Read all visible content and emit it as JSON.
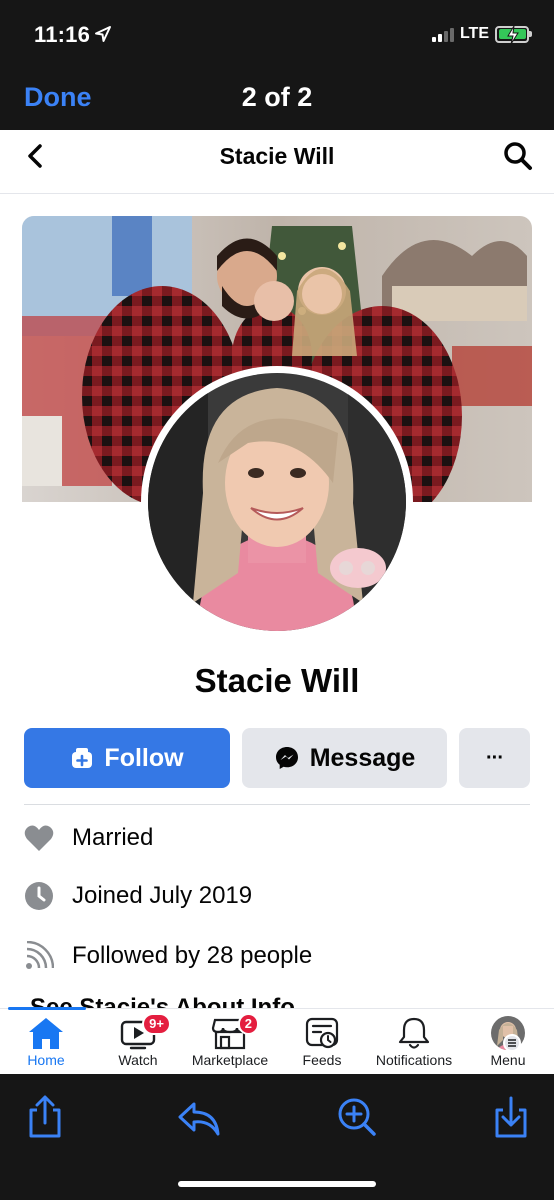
{
  "status": {
    "time": "11:16",
    "network": "LTE"
  },
  "viewer": {
    "done_label": "Done",
    "count": "2 of 2"
  },
  "fb_header": {
    "title": "Stacie Will"
  },
  "profile": {
    "name": "Stacie Will",
    "follow_label": "Follow",
    "message_label": "Message",
    "more_label": "···"
  },
  "info": [
    {
      "icon": "heart-icon",
      "text": "Married"
    },
    {
      "icon": "clock-icon",
      "text": "Joined July 2019"
    },
    {
      "icon": "rss-icon",
      "text": "Followed by 28 people"
    }
  ],
  "partial_text": "See Stacie's About Info",
  "tabs": [
    {
      "label": "Home",
      "icon": "home-icon",
      "active": true
    },
    {
      "label": "Watch",
      "icon": "watch-icon",
      "badge": "9+"
    },
    {
      "label": "Marketplace",
      "icon": "marketplace-icon",
      "badge": "2"
    },
    {
      "label": "Feeds",
      "icon": "feeds-icon"
    },
    {
      "label": "Notifications",
      "icon": "bell-icon"
    },
    {
      "label": "Menu",
      "icon": "menu-avatar"
    }
  ],
  "colors": {
    "accent": "#3578e5",
    "badge": "#e41e3f",
    "ios_blue": "#3b82f6"
  }
}
